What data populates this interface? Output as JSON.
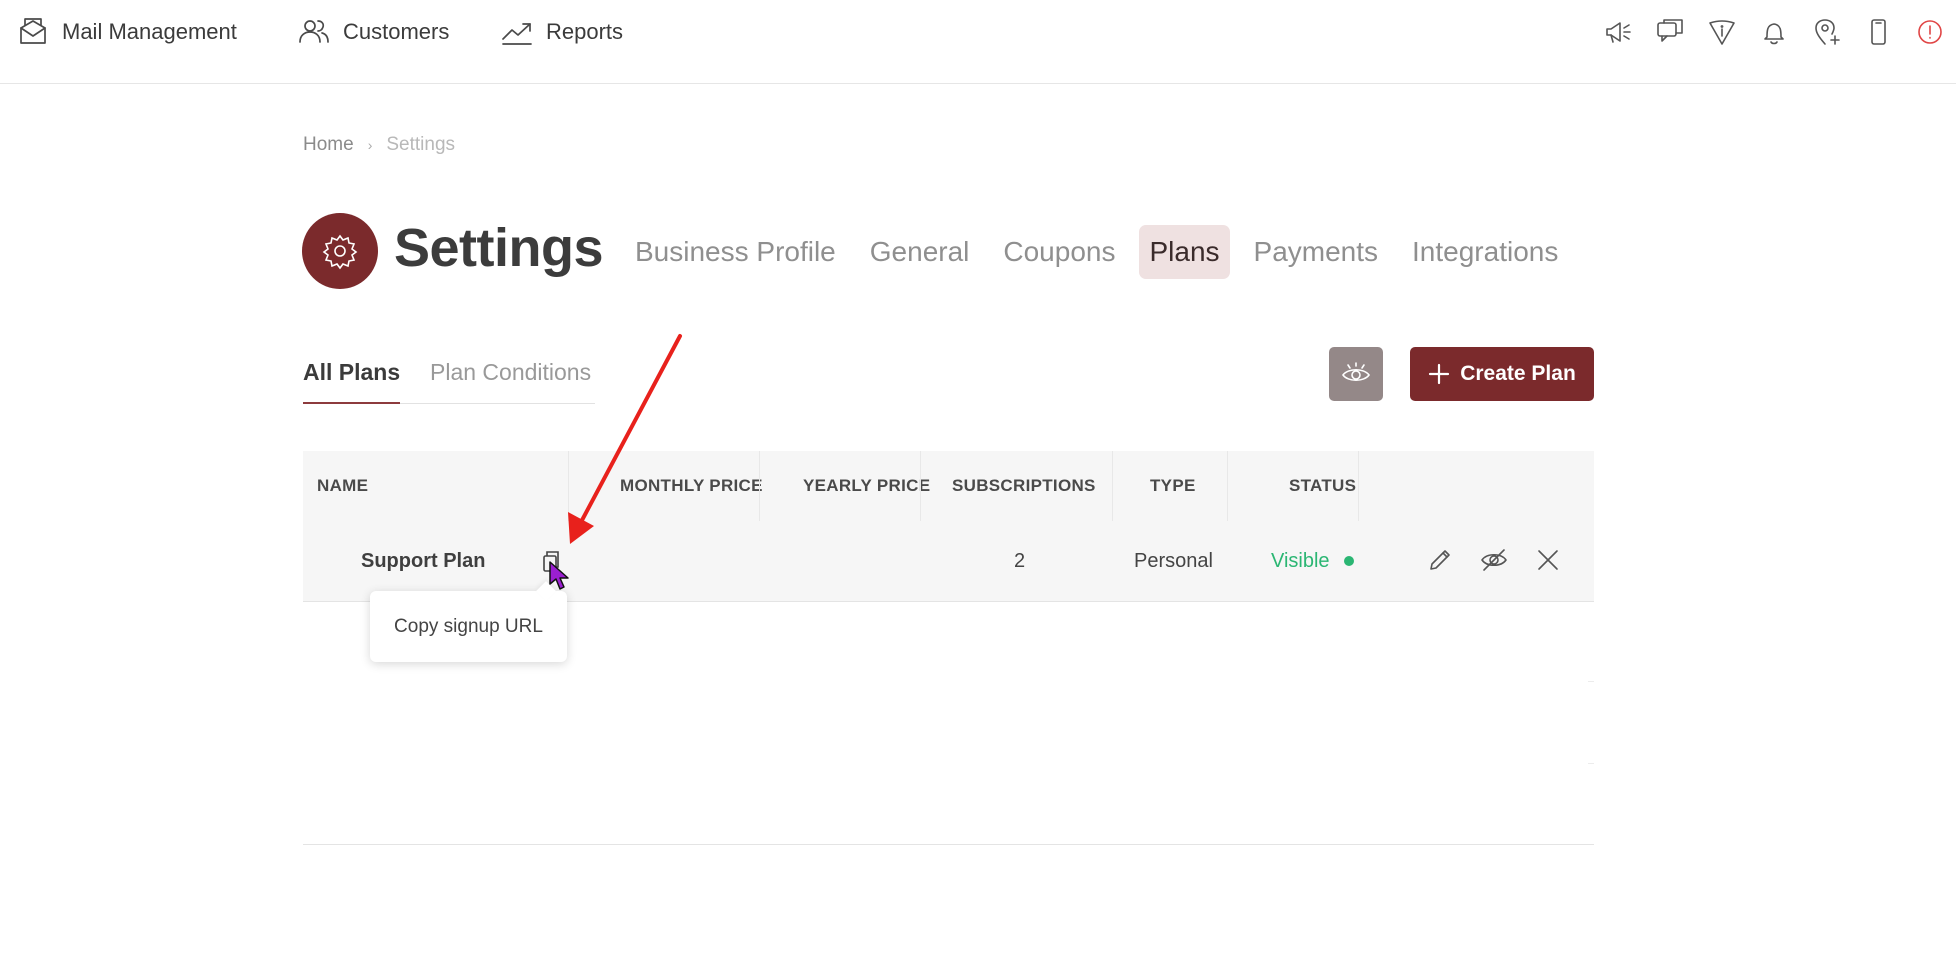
{
  "nav": {
    "items": [
      {
        "label": "Mail Management",
        "icon": "mail-stack-icon"
      },
      {
        "label": "Customers",
        "icon": "users-icon"
      },
      {
        "label": "Reports",
        "icon": "trend-chart-icon"
      }
    ],
    "right_icons": [
      "megaphone-icon",
      "chat-icon",
      "guide-icon",
      "bell-icon",
      "location-add-icon",
      "mobile-icon",
      "alert-icon"
    ],
    "alert_color": "#e04545"
  },
  "breadcrumb": {
    "home": "Home",
    "current": "Settings"
  },
  "page": {
    "title": "Settings",
    "accent": "#7b2a2c"
  },
  "main_tabs": [
    {
      "label": "Business Profile",
      "active": false
    },
    {
      "label": "General",
      "active": false
    },
    {
      "label": "Coupons",
      "active": false
    },
    {
      "label": "Plans",
      "active": true
    },
    {
      "label": "Payments",
      "active": false
    },
    {
      "label": "Integrations",
      "active": false
    }
  ],
  "sub_tabs": [
    {
      "label": "All Plans",
      "active": true
    },
    {
      "label": "Plan Conditions",
      "active": false
    }
  ],
  "toolbar": {
    "create_label": "Create Plan"
  },
  "table": {
    "columns": [
      "NAME",
      "MONTHLY PRICE",
      "YEARLY PRICE",
      "SUBSCRIPTIONS",
      "TYPE",
      "STATUS"
    ],
    "rows": [
      {
        "name": "Support Plan",
        "monthly_price": "",
        "yearly_price": "",
        "subscriptions": "2",
        "type": "Personal",
        "status": "Visible",
        "status_color": "#2bb673"
      }
    ]
  },
  "tooltip": {
    "text": "Copy signup URL"
  }
}
